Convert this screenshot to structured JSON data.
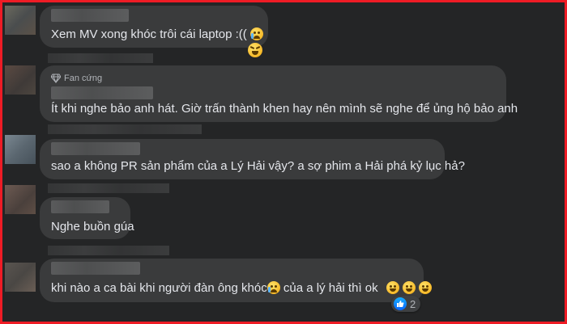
{
  "comments": [
    {
      "text": "Xem MV xong khóc trôi cái laptop :((",
      "emojis": [
        "crying-face-icon",
        "squinting-tongue-face-icon"
      ]
    },
    {
      "badge": "Fan cứng",
      "badge_icon": "diamond-icon",
      "text": "Ít khi nghe bảo anh hát. Giờ trấn thành khen hay nên mình sẽ nghe để ủng hộ bảo anh"
    },
    {
      "text": "sao a không PR sản phẩm của a Lý Hải vậy? a sợ phim a Hải phá kỷ lục hả?"
    },
    {
      "text": "Nghe buồn gúa"
    },
    {
      "text_part1": "khi nào a ca bài khi người đàn ông khóc",
      "text_part2": " của a lý hải thì ok",
      "emojis": [
        "crying-face-icon",
        "grinning-sweat-icon",
        "grinning-sweat-icon",
        "grinning-sweat-icon"
      ],
      "reaction": {
        "icon": "like-icon",
        "count": "2"
      }
    }
  ],
  "colors": {
    "frame": "#ee1c25",
    "background": "#242526",
    "bubble": "#3a3b3c",
    "text": "#e4e6eb",
    "like": "#0866ff"
  }
}
